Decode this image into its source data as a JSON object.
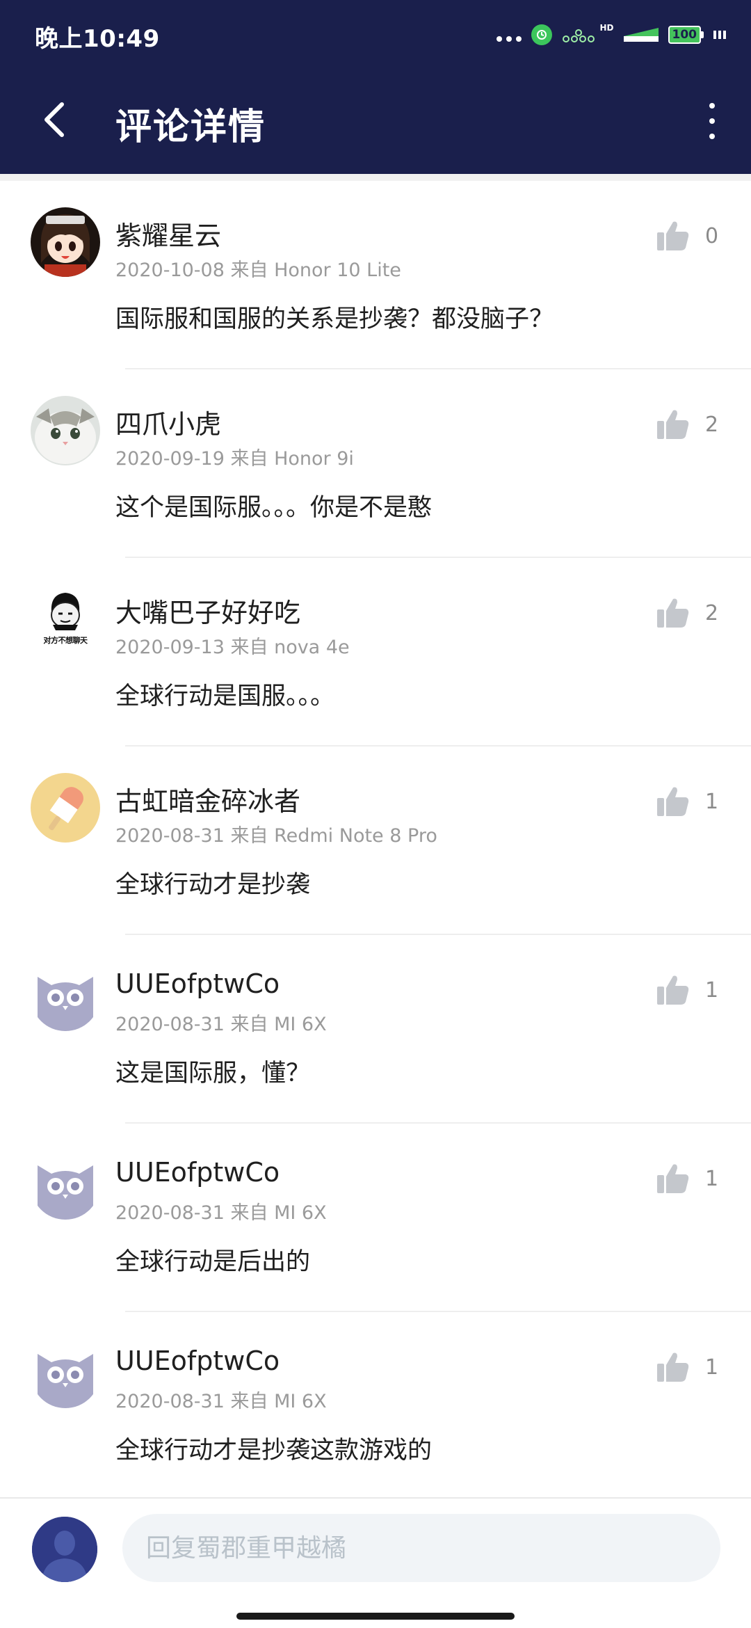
{
  "status_bar": {
    "time": "晚上10:49",
    "hd_label": "HD",
    "battery_level": "100"
  },
  "header": {
    "title": "评论详情",
    "background_color": "#1a1f4c"
  },
  "comments": [
    {
      "username": "紫耀星云",
      "meta": "2020-10-08 来自 Honor 10 Lite",
      "content": "国际服和国服的关系是抄袭？都没脑子？",
      "likes": "0",
      "avatar": "anime-girl-avatar"
    },
    {
      "username": "四爪小虎",
      "meta": "2020-09-19 来自 Honor 9i",
      "content": "这个是国际服。。。你是不是憨",
      "likes": "2",
      "avatar": "cat-avatar"
    },
    {
      "username": "大嘴巴子好好吃",
      "meta": "2020-09-13 来自 nova 4e",
      "content": "全球行动是国服。。。",
      "likes": "2",
      "avatar": "meme-face-avatar",
      "avatar_caption": "对方不想聊天"
    },
    {
      "username": "古虹暗金碎冰者",
      "meta": "2020-08-31 来自 Redmi Note 8 Pro",
      "content": "全球行动才是抄袭",
      "likes": "1",
      "avatar": "popsicle-avatar"
    },
    {
      "username": "UUEofptwCo",
      "meta": "2020-08-31 来自 MI 6X",
      "content": "这是国际服，懂？",
      "likes": "1",
      "avatar": "owl-avatar"
    },
    {
      "username": "UUEofptwCo",
      "meta": "2020-08-31 来自 MI 6X",
      "content": "全球行动是后出的",
      "likes": "1",
      "avatar": "owl-avatar"
    },
    {
      "username": "UUEofptwCo",
      "meta": "2020-08-31 来自 MI 6X",
      "content": "全球行动才是抄袭这款游戏的",
      "likes": "1",
      "avatar": "owl-avatar"
    }
  ],
  "reply": {
    "placeholder": "回复蜀郡重甲越橘"
  }
}
